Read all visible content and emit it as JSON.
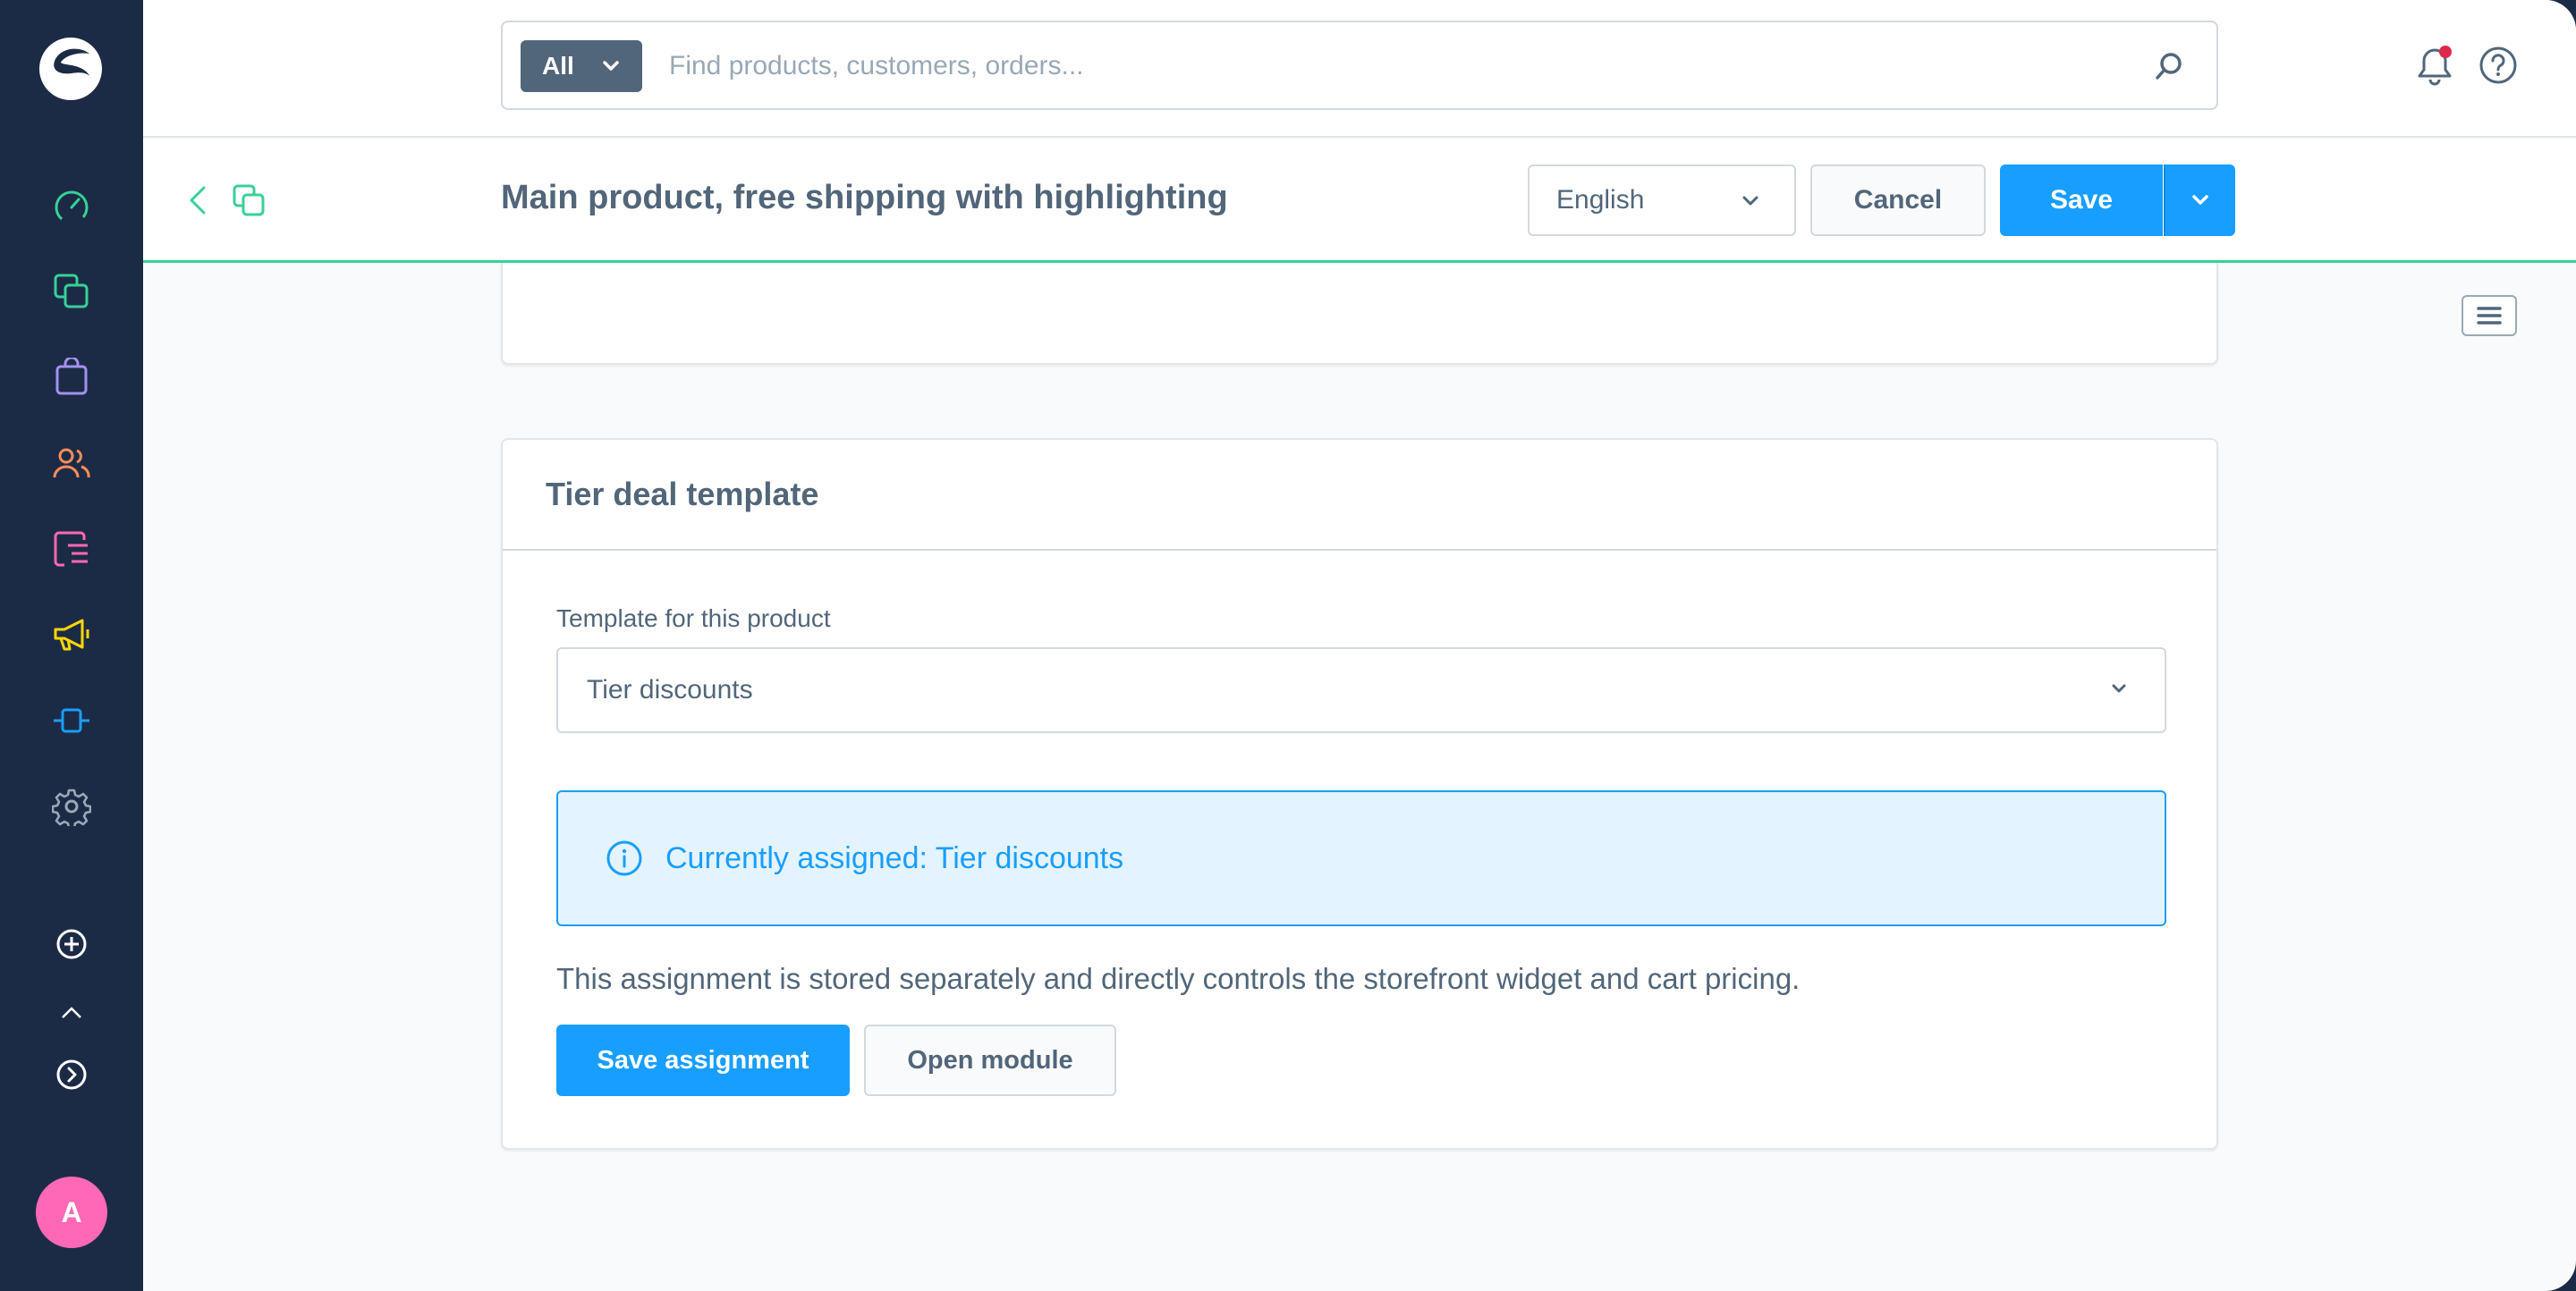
{
  "colors": {
    "sidebar_bg": "#1c2b45",
    "primary": "#189eff",
    "accent_green": "#37d197",
    "text": "#52667a",
    "avatar_bg": "#ff68b4",
    "notification_dot": "#de294c"
  },
  "sidebar": {
    "items": [
      {
        "icon": "dashboard-icon",
        "color": "#37d197"
      },
      {
        "icon": "catalogues-icon",
        "color": "#37d197"
      },
      {
        "icon": "orders-icon",
        "color": "#a092f0"
      },
      {
        "icon": "customers-icon",
        "color": "#ff8c5a"
      },
      {
        "icon": "content-icon",
        "color": "#ff68b4"
      },
      {
        "icon": "marketing-icon",
        "color": "#ffd700"
      },
      {
        "icon": "extensions-icon",
        "color": "#189eff"
      },
      {
        "icon": "settings-icon",
        "color": "#9aa8b5"
      },
      {
        "icon": "add-sales-channel-icon",
        "color": "#ffffff"
      },
      {
        "icon": "expand-sidebar-icon",
        "color": "#ffffff"
      }
    ],
    "avatar_initial": "A"
  },
  "search": {
    "type_label": "All",
    "placeholder": "Find products, customers, orders..."
  },
  "smartbar": {
    "title": "Main product, free shipping with highlighting",
    "language": "English",
    "cancel_label": "Cancel",
    "save_label": "Save"
  },
  "card": {
    "title": "Tier deal template",
    "field_label": "Template for this product",
    "selected_template": "Tier discounts",
    "alert_text": "Currently assigned: Tier discounts",
    "help_text": "This assignment is stored separately and directly controls the storefront widget and cart pricing.",
    "save_assignment_label": "Save assignment",
    "open_module_label": "Open module"
  }
}
